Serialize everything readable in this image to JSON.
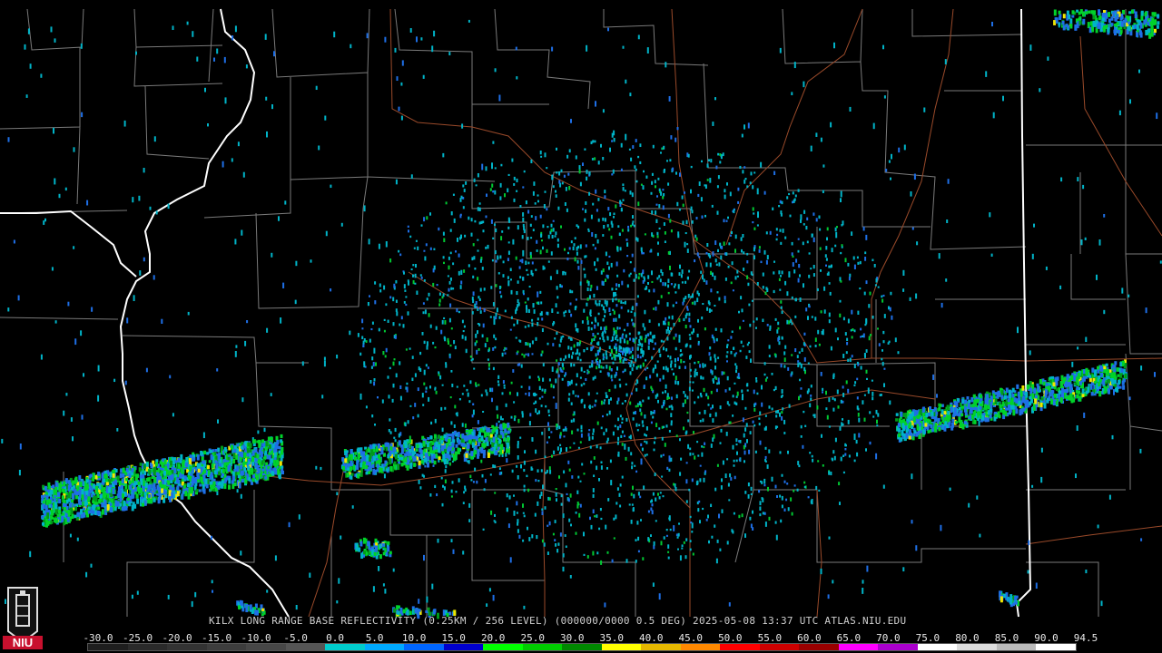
{
  "caption": "KILX LONG RANGE BASE REFLECTIVITY (0.25KM / 256 LEVEL) (000000/0000 0.5 DEG) 2025-05-08 13:37 UTC  ATLAS.NIU.EDU",
  "logo": {
    "text": "NIU",
    "icon": "university-tower-icon"
  },
  "scale": {
    "labels": [
      "-30.0",
      "-25.0",
      "-20.0",
      "-15.0",
      "-10.0",
      "-5.0",
      "0.0",
      "5.0",
      "10.0",
      "15.0",
      "20.0",
      "25.0",
      "30.0",
      "35.0",
      "40.0",
      "45.0",
      "50.0",
      "55.0",
      "60.0",
      "65.0",
      "70.0",
      "75.0",
      "80.0",
      "85.0",
      "90.0",
      "94.5"
    ],
    "colors": [
      "#1e1e1e",
      "#2a2a2a",
      "#333333",
      "#3d3d3d",
      "#474747",
      "#555555",
      "#00cccc",
      "#00aaff",
      "#0066ff",
      "#0000cc",
      "#00ff00",
      "#00cc00",
      "#008800",
      "#ffff00",
      "#e6b800",
      "#ff8800",
      "#ff0000",
      "#cc0000",
      "#990000",
      "#ff00ff",
      "#aa00cc",
      "#ffffff",
      "#dddddd",
      "#bbbbbb",
      "#ffffff"
    ]
  },
  "colors": {
    "county": "#7a7a7a",
    "state": "#ffffff",
    "road": "#9a4a2a"
  }
}
